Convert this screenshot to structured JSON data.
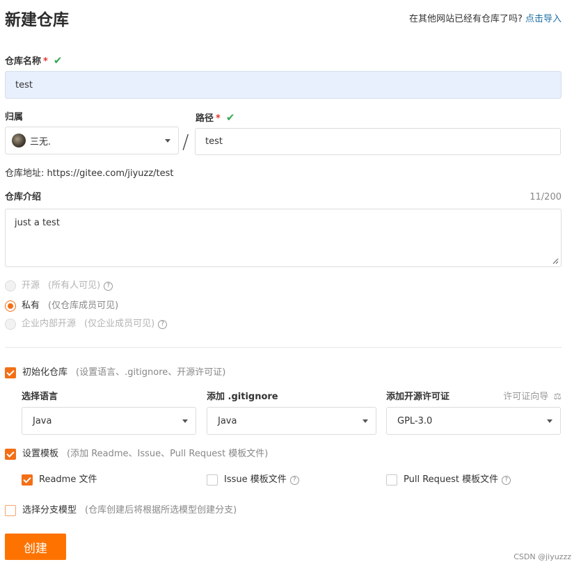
{
  "header": {
    "title": "新建仓库",
    "import_hint": "在其他网站已经有仓库了吗?",
    "import_link": "点击导入"
  },
  "repo_name": {
    "label": "仓库名称",
    "required_mark": "*",
    "value": "test"
  },
  "owner": {
    "label": "归属",
    "value": "三无."
  },
  "path": {
    "label": "路径",
    "required_mark": "*",
    "value": "test",
    "separator": "/"
  },
  "repo_address": {
    "label": "仓库地址:",
    "url": "https://gitee.com/jiyuzz/test"
  },
  "description": {
    "label": "仓库介绍",
    "counter": "11/200",
    "value": "just a test"
  },
  "visibility": {
    "options": [
      {
        "label": "开源",
        "desc": "(所有人可见)",
        "selected": false,
        "disabled": true,
        "help": "?"
      },
      {
        "label": "私有",
        "desc": "(仅仓库成员可见)",
        "selected": true,
        "disabled": false
      },
      {
        "label": "企业内部开源",
        "desc": "(仅企业成员可见)",
        "selected": false,
        "disabled": true,
        "help": "?"
      }
    ]
  },
  "init_repo": {
    "label": "初始化仓库",
    "desc": "(设置语言、.gitignore、开源许可证)",
    "checked": true,
    "language": {
      "label": "选择语言",
      "value": "Java"
    },
    "gitignore": {
      "label": "添加 .gitignore",
      "value": "Java"
    },
    "license": {
      "label": "添加开源许可证",
      "value": "GPL-3.0",
      "guide": "许可证向导"
    }
  },
  "template": {
    "label": "设置模板",
    "desc": "(添加 Readme、Issue、Pull Request 模板文件)",
    "checked": true,
    "options": [
      {
        "label": "Readme 文件",
        "checked": true
      },
      {
        "label": "Issue 模板文件",
        "checked": false,
        "help": "?"
      },
      {
        "label": "Pull Request 模板文件",
        "checked": false,
        "help": "?"
      }
    ]
  },
  "branch_model": {
    "label": "选择分支模型",
    "desc": "(仓库创建后将根据所选模型创建分支)",
    "checked": false
  },
  "submit": {
    "label": "创建"
  },
  "watermark": "CSDN @jiyuzzz",
  "colors": {
    "accent": "#fe7300",
    "link": "#1d6fa5",
    "success": "#35a853",
    "required": "#e0372c"
  }
}
